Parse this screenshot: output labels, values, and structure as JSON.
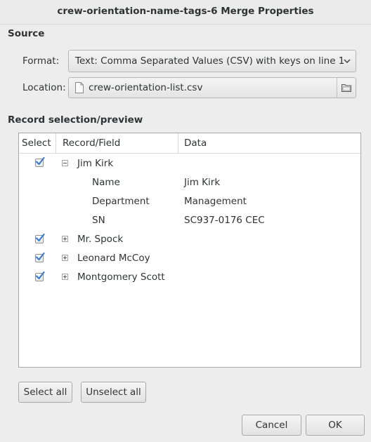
{
  "window": {
    "title": "crew-orientation-name-tags-6 Merge Properties"
  },
  "source": {
    "heading": "Source",
    "format_label": "Format:",
    "format_value": "Text: Comma Separated Values (CSV) with keys on line 1",
    "location_label": "Location:",
    "location_value": "crew-orientation-list.csv"
  },
  "preview": {
    "heading": "Record selection/preview",
    "columns": [
      "Select",
      "Record/Field",
      "Data"
    ],
    "records": [
      {
        "name": "Jim Kirk",
        "selected": true,
        "expanded": true,
        "fields": [
          {
            "field": "Name",
            "data": "Jim Kirk"
          },
          {
            "field": "Department",
            "data": "Management"
          },
          {
            "field": "SN",
            "data": "SC937-0176 CEC"
          }
        ]
      },
      {
        "name": "Mr. Spock",
        "selected": true,
        "expanded": false
      },
      {
        "name": "Leonard McCoy",
        "selected": true,
        "expanded": false
      },
      {
        "name": "Montgomery Scott",
        "selected": true,
        "expanded": false
      }
    ]
  },
  "actions": {
    "select_all": "Select all",
    "unselect_all": "Unselect all",
    "cancel": "Cancel",
    "ok": "OK"
  },
  "icons": {
    "combo_arrow": "chevron-down-icon",
    "file": "document-icon",
    "folder": "folder-icon",
    "check": "checkmark-icon",
    "collapse": "minus-box-icon",
    "expand": "plus-box-icon"
  },
  "colors": {
    "window_bg": "#ededed",
    "check_blue": "#3a7bd5",
    "text": "#2e3436"
  }
}
